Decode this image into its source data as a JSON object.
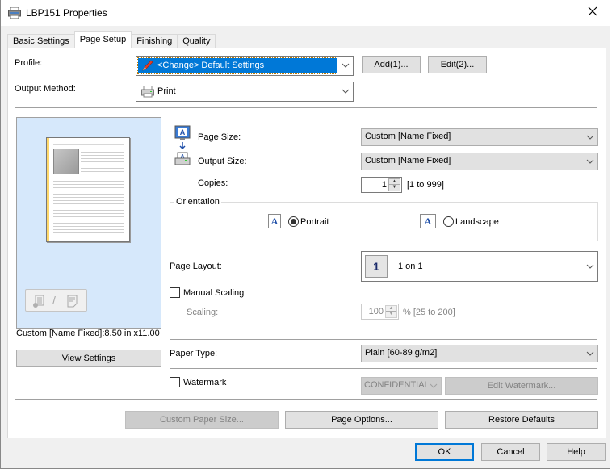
{
  "window": {
    "title": "LBP151 Properties",
    "close_label": "✕"
  },
  "tabs": [
    {
      "label": "Basic Settings",
      "active": false
    },
    {
      "label": "Page Setup",
      "active": true
    },
    {
      "label": "Finishing",
      "active": false
    },
    {
      "label": "Quality",
      "active": false
    }
  ],
  "profile": {
    "label": "Profile:",
    "value": "<Change> Default Settings",
    "add_button": "Add(1)...",
    "edit_button": "Edit(2)..."
  },
  "output_method": {
    "label": "Output Method:",
    "value": "Print"
  },
  "preview": {
    "status_text": "Custom [Name Fixed]:8.50 in x11.00 in",
    "view_settings_button": "View Settings"
  },
  "page_size": {
    "label": "Page Size:",
    "value": "Custom [Name Fixed]"
  },
  "output_size": {
    "label": "Output Size:",
    "value": "Custom [Name Fixed]"
  },
  "copies": {
    "label": "Copies:",
    "value": "1",
    "range": "[1 to 999]"
  },
  "orientation": {
    "title": "Orientation",
    "portrait_label": "Portrait",
    "landscape_label": "Landscape",
    "icon_glyph": "A",
    "selected": "Portrait"
  },
  "page_layout": {
    "label": "Page Layout:",
    "icon_number": "1",
    "value": "1 on 1"
  },
  "manual_scaling": {
    "label": "Manual Scaling",
    "checked": false,
    "scaling_label": "Scaling:",
    "scaling_value": "100",
    "scaling_range": "% [25 to 200]"
  },
  "paper_type": {
    "label": "Paper Type:",
    "value": "Plain [60-89 g/m2]"
  },
  "watermark": {
    "label": "Watermark",
    "checked": false,
    "value": "CONFIDENTIAL",
    "edit_button": "Edit Watermark..."
  },
  "bottom_buttons": {
    "custom_paper_size": "Custom Paper Size...",
    "page_options": "Page Options...",
    "restore_defaults": "Restore Defaults"
  },
  "footer": {
    "ok": "OK",
    "cancel": "Cancel",
    "help": "Help"
  },
  "colors": {
    "selection": "#0078d7",
    "preview_bg": "#d6e8fb"
  }
}
